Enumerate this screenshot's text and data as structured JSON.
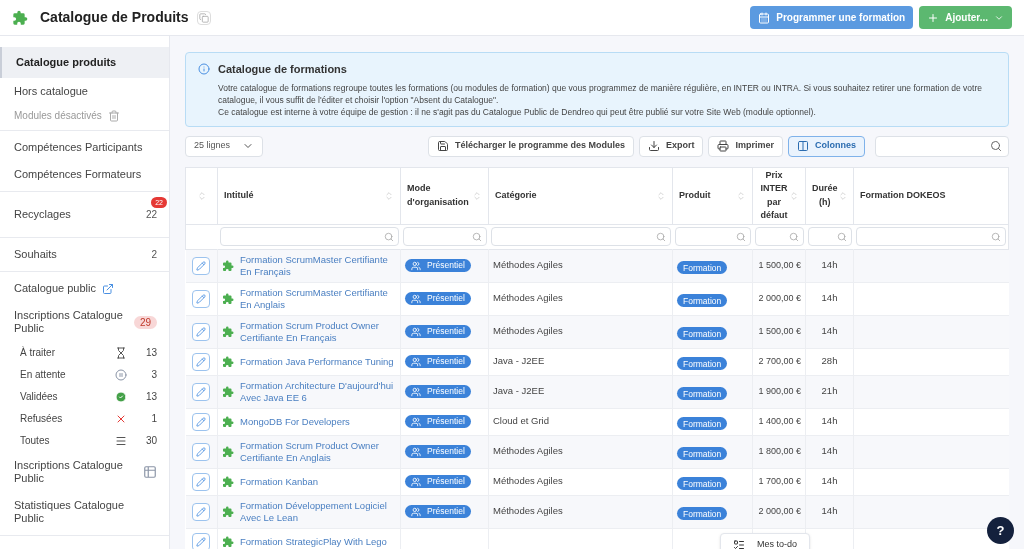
{
  "header": {
    "title": "Catalogue de Produits",
    "buttons": [
      {
        "kind": "schedule",
        "label": "Programmer une formation"
      },
      {
        "kind": "add",
        "label": "Ajouter..."
      }
    ]
  },
  "sidebar": {
    "sections": [
      [
        {
          "kind": "main",
          "label": "Catalogue produits",
          "selected": true
        },
        {
          "kind": "main",
          "label": "Hors catalogue",
          "selected": false
        },
        {
          "kind": "muted",
          "label": "Modules désactivés",
          "selected": false
        }
      ],
      [
        {
          "kind": "main",
          "label": "Compétences Participants",
          "selected": false
        },
        {
          "kind": "main",
          "label": "Compétences Formateurs",
          "selected": false
        }
      ],
      [
        {
          "kind": "main",
          "label": "Recyclages",
          "count": "22",
          "alert": "22",
          "selected": false
        }
      ],
      [
        {
          "kind": "main",
          "label": "Souhaits",
          "count": "2",
          "selected": false
        }
      ],
      [
        {
          "kind": "external",
          "label": "Catalogue public",
          "selected": false
        },
        {
          "kind": "main",
          "label": "Inscriptions Catalogue Public",
          "pill": "29",
          "selected": false
        },
        {
          "kind": "pending",
          "label": "À traiter",
          "count": "13",
          "selected": false
        },
        {
          "kind": "waiting",
          "label": "En attente",
          "count": "3",
          "selected": false
        },
        {
          "kind": "validated",
          "label": "Validées",
          "count": "13",
          "selected": false
        },
        {
          "kind": "refused",
          "label": "Refusées",
          "count": "1",
          "selected": false
        },
        {
          "kind": "all",
          "label": "Toutes",
          "count": "30",
          "selected": false
        },
        {
          "kind": "grid",
          "label": "Inscriptions Catalogue Public",
          "selected": false
        },
        {
          "kind": "main",
          "label": "Statistiques Catalogue Public",
          "selected": false
        }
      ]
    ]
  },
  "info": {
    "title": "Catalogue de formations",
    "lines": [
      "Votre catalogue de formations regroupe toutes les formations (ou modules de formation) que vous programmez de manière régulière, en INTER ou INTRA. Si vous souhaitez retirer une formation de votre catalogue, il vous suffit de l'éditer et choisir l'option \"Absent du Catalogue\".",
      "Ce catalogue est interne à votre équipe de gestion : il ne s'agit pas du Catalogue Public de Dendreo qui peut être publié sur votre Site Web (module optionnel)."
    ]
  },
  "toolbar": {
    "page_size": "25 lignes",
    "buttons": [
      {
        "kind": "download",
        "label": "Télécharger le programme des Modules",
        "selected": false
      },
      {
        "kind": "export",
        "label": "Export",
        "selected": false
      },
      {
        "kind": "print",
        "label": "Imprimer",
        "selected": false
      },
      {
        "kind": "columns",
        "label": "Colonnes",
        "selected": true
      }
    ]
  },
  "table": {
    "columns": [
      "Intitulé",
      "Mode d'organisation",
      "Catégorie",
      "Produit",
      "Prix INTER par défaut",
      "Durée (h)",
      "Formation DOKEOS"
    ],
    "rows": [
      {
        "title": "Formation ScrumMaster Certifiante En Français",
        "mode": "Présentiel",
        "category": "Méthodes Agiles",
        "product": "Formation",
        "price": "1 500,00 €",
        "duration": "14h"
      },
      {
        "title": "Formation ScrumMaster Certifiante En Anglais",
        "mode": "Présentiel",
        "category": "Méthodes Agiles",
        "product": "Formation",
        "price": "2 000,00 €",
        "duration": "14h"
      },
      {
        "title": "Formation Scrum Product Owner Certifiante En Français",
        "mode": "Présentiel",
        "category": "Méthodes Agiles",
        "product": "Formation",
        "price": "1 500,00 €",
        "duration": "14h"
      },
      {
        "title": "Formation Java Performance Tuning",
        "mode": "Présentiel",
        "category": "Java - J2EE",
        "product": "Formation",
        "price": "2 700,00 €",
        "duration": "28h"
      },
      {
        "title": "Formation Architecture D'aujourd'hui Avec Java EE 6",
        "mode": "Présentiel",
        "category": "Java - J2EE",
        "product": "Formation",
        "price": "1 900,00 €",
        "duration": "21h"
      },
      {
        "title": "MongoDB For Developers",
        "mode": "Présentiel",
        "category": "Cloud et Grid",
        "product": "Formation",
        "price": "1 400,00 €",
        "duration": "14h"
      },
      {
        "title": "Formation Scrum Product Owner Certifiante En Anglais",
        "mode": "Présentiel",
        "category": "Méthodes Agiles",
        "product": "Formation",
        "price": "1 800,00 €",
        "duration": "14h"
      },
      {
        "title": "Formation Kanban",
        "mode": "Présentiel",
        "category": "Méthodes Agiles",
        "product": "Formation",
        "price": "1 700,00 €",
        "duration": "14h"
      },
      {
        "title": "Formation Développement Logiciel Avec Le Lean",
        "mode": "Présentiel",
        "category": "Méthodes Agiles",
        "product": "Formation",
        "price": "2 000,00 €",
        "duration": "14h"
      },
      {
        "title": "Formation StrategicPlay With Lego"
      }
    ]
  },
  "todo": {
    "label": "Mes to-do"
  },
  "help": {
    "label": "?"
  }
}
